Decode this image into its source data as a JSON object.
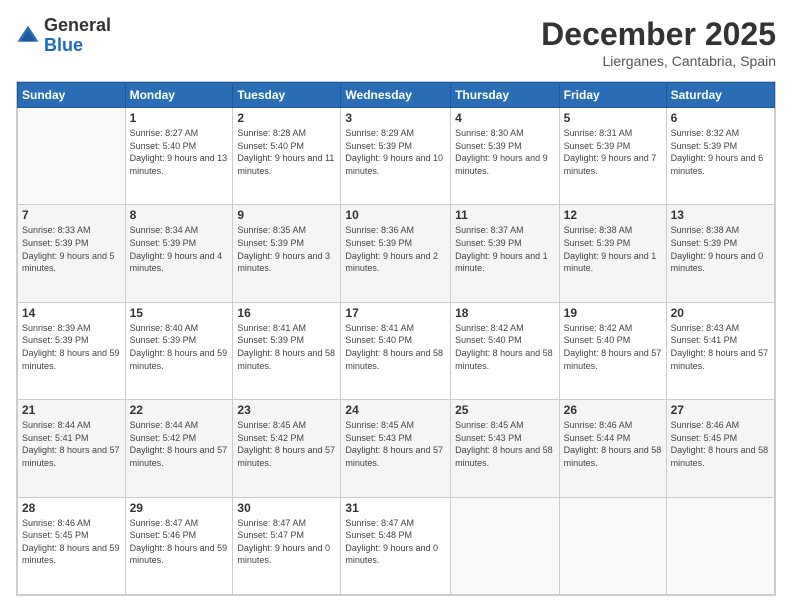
{
  "logo": {
    "general": "General",
    "blue": "Blue"
  },
  "header": {
    "month": "December 2025",
    "location": "Lierganes, Cantabria, Spain"
  },
  "weekdays": [
    "Sunday",
    "Monday",
    "Tuesday",
    "Wednesday",
    "Thursday",
    "Friday",
    "Saturday"
  ],
  "weeks": [
    [
      {
        "day": "",
        "sunrise": "",
        "sunset": "",
        "daylight": ""
      },
      {
        "day": "1",
        "sunrise": "Sunrise: 8:27 AM",
        "sunset": "Sunset: 5:40 PM",
        "daylight": "Daylight: 9 hours and 13 minutes."
      },
      {
        "day": "2",
        "sunrise": "Sunrise: 8:28 AM",
        "sunset": "Sunset: 5:40 PM",
        "daylight": "Daylight: 9 hours and 11 minutes."
      },
      {
        "day": "3",
        "sunrise": "Sunrise: 8:29 AM",
        "sunset": "Sunset: 5:39 PM",
        "daylight": "Daylight: 9 hours and 10 minutes."
      },
      {
        "day": "4",
        "sunrise": "Sunrise: 8:30 AM",
        "sunset": "Sunset: 5:39 PM",
        "daylight": "Daylight: 9 hours and 9 minutes."
      },
      {
        "day": "5",
        "sunrise": "Sunrise: 8:31 AM",
        "sunset": "Sunset: 5:39 PM",
        "daylight": "Daylight: 9 hours and 7 minutes."
      },
      {
        "day": "6",
        "sunrise": "Sunrise: 8:32 AM",
        "sunset": "Sunset: 5:39 PM",
        "daylight": "Daylight: 9 hours and 6 minutes."
      }
    ],
    [
      {
        "day": "7",
        "sunrise": "Sunrise: 8:33 AM",
        "sunset": "Sunset: 5:39 PM",
        "daylight": "Daylight: 9 hours and 5 minutes."
      },
      {
        "day": "8",
        "sunrise": "Sunrise: 8:34 AM",
        "sunset": "Sunset: 5:39 PM",
        "daylight": "Daylight: 9 hours and 4 minutes."
      },
      {
        "day": "9",
        "sunrise": "Sunrise: 8:35 AM",
        "sunset": "Sunset: 5:39 PM",
        "daylight": "Daylight: 9 hours and 3 minutes."
      },
      {
        "day": "10",
        "sunrise": "Sunrise: 8:36 AM",
        "sunset": "Sunset: 5:39 PM",
        "daylight": "Daylight: 9 hours and 2 minutes."
      },
      {
        "day": "11",
        "sunrise": "Sunrise: 8:37 AM",
        "sunset": "Sunset: 5:39 PM",
        "daylight": "Daylight: 9 hours and 1 minute."
      },
      {
        "day": "12",
        "sunrise": "Sunrise: 8:38 AM",
        "sunset": "Sunset: 5:39 PM",
        "daylight": "Daylight: 9 hours and 1 minute."
      },
      {
        "day": "13",
        "sunrise": "Sunrise: 8:38 AM",
        "sunset": "Sunset: 5:39 PM",
        "daylight": "Daylight: 9 hours and 0 minutes."
      }
    ],
    [
      {
        "day": "14",
        "sunrise": "Sunrise: 8:39 AM",
        "sunset": "Sunset: 5:39 PM",
        "daylight": "Daylight: 8 hours and 59 minutes."
      },
      {
        "day": "15",
        "sunrise": "Sunrise: 8:40 AM",
        "sunset": "Sunset: 5:39 PM",
        "daylight": "Daylight: 8 hours and 59 minutes."
      },
      {
        "day": "16",
        "sunrise": "Sunrise: 8:41 AM",
        "sunset": "Sunset: 5:39 PM",
        "daylight": "Daylight: 8 hours and 58 minutes."
      },
      {
        "day": "17",
        "sunrise": "Sunrise: 8:41 AM",
        "sunset": "Sunset: 5:40 PM",
        "daylight": "Daylight: 8 hours and 58 minutes."
      },
      {
        "day": "18",
        "sunrise": "Sunrise: 8:42 AM",
        "sunset": "Sunset: 5:40 PM",
        "daylight": "Daylight: 8 hours and 58 minutes."
      },
      {
        "day": "19",
        "sunrise": "Sunrise: 8:42 AM",
        "sunset": "Sunset: 5:40 PM",
        "daylight": "Daylight: 8 hours and 57 minutes."
      },
      {
        "day": "20",
        "sunrise": "Sunrise: 8:43 AM",
        "sunset": "Sunset: 5:41 PM",
        "daylight": "Daylight: 8 hours and 57 minutes."
      }
    ],
    [
      {
        "day": "21",
        "sunrise": "Sunrise: 8:44 AM",
        "sunset": "Sunset: 5:41 PM",
        "daylight": "Daylight: 8 hours and 57 minutes."
      },
      {
        "day": "22",
        "sunrise": "Sunrise: 8:44 AM",
        "sunset": "Sunset: 5:42 PM",
        "daylight": "Daylight: 8 hours and 57 minutes."
      },
      {
        "day": "23",
        "sunrise": "Sunrise: 8:45 AM",
        "sunset": "Sunset: 5:42 PM",
        "daylight": "Daylight: 8 hours and 57 minutes."
      },
      {
        "day": "24",
        "sunrise": "Sunrise: 8:45 AM",
        "sunset": "Sunset: 5:43 PM",
        "daylight": "Daylight: 8 hours and 57 minutes."
      },
      {
        "day": "25",
        "sunrise": "Sunrise: 8:45 AM",
        "sunset": "Sunset: 5:43 PM",
        "daylight": "Daylight: 8 hours and 58 minutes."
      },
      {
        "day": "26",
        "sunrise": "Sunrise: 8:46 AM",
        "sunset": "Sunset: 5:44 PM",
        "daylight": "Daylight: 8 hours and 58 minutes."
      },
      {
        "day": "27",
        "sunrise": "Sunrise: 8:46 AM",
        "sunset": "Sunset: 5:45 PM",
        "daylight": "Daylight: 8 hours and 58 minutes."
      }
    ],
    [
      {
        "day": "28",
        "sunrise": "Sunrise: 8:46 AM",
        "sunset": "Sunset: 5:45 PM",
        "daylight": "Daylight: 8 hours and 59 minutes."
      },
      {
        "day": "29",
        "sunrise": "Sunrise: 8:47 AM",
        "sunset": "Sunset: 5:46 PM",
        "daylight": "Daylight: 8 hours and 59 minutes."
      },
      {
        "day": "30",
        "sunrise": "Sunrise: 8:47 AM",
        "sunset": "Sunset: 5:47 PM",
        "daylight": "Daylight: 9 hours and 0 minutes."
      },
      {
        "day": "31",
        "sunrise": "Sunrise: 8:47 AM",
        "sunset": "Sunset: 5:48 PM",
        "daylight": "Daylight: 9 hours and 0 minutes."
      },
      {
        "day": "",
        "sunrise": "",
        "sunset": "",
        "daylight": ""
      },
      {
        "day": "",
        "sunrise": "",
        "sunset": "",
        "daylight": ""
      },
      {
        "day": "",
        "sunrise": "",
        "sunset": "",
        "daylight": ""
      }
    ]
  ]
}
